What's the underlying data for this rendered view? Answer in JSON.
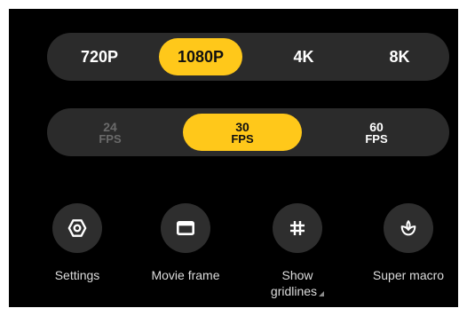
{
  "resolution": {
    "options": [
      "720P",
      "1080P",
      "4K",
      "8K"
    ],
    "selected": "1080P"
  },
  "frame_rate": {
    "options": [
      {
        "value": "24",
        "unit": "FPS",
        "enabled": false
      },
      {
        "value": "30",
        "unit": "FPS",
        "enabled": true
      },
      {
        "value": "60",
        "unit": "FPS",
        "enabled": true
      }
    ],
    "selected": "30"
  },
  "tools": [
    {
      "label": "Settings",
      "icon": "settings-icon"
    },
    {
      "label": "Movie frame",
      "icon": "movie-frame-icon"
    },
    {
      "label": "Show gridlines",
      "label_line1": "Show",
      "label_line2": "gridlines",
      "icon": "grid-icon"
    },
    {
      "label": "Super macro",
      "icon": "macro-flower-icon"
    }
  ],
  "colors": {
    "accent": "#ffc81a",
    "background": "#000000",
    "pill": "#2b2b2b",
    "button": "#2e2e2e",
    "disabled_text": "#6a6a6a"
  }
}
